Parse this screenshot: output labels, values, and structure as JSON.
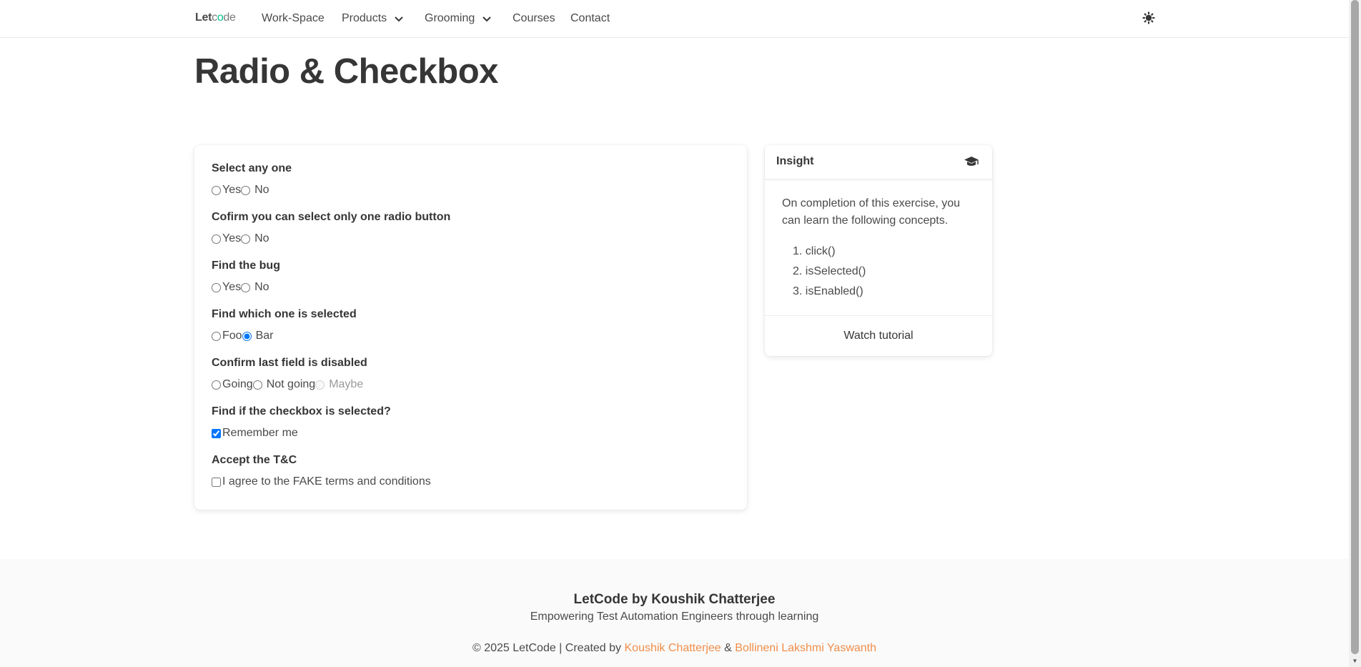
{
  "nav": {
    "logo_let": "Let",
    "logo_c": "c",
    "logo_o": "o",
    "logo_de": "de",
    "items": [
      {
        "label": "Work-Space"
      },
      {
        "label": "Products"
      },
      {
        "label": "Grooming"
      },
      {
        "label": "Courses"
      },
      {
        "label": "Contact"
      }
    ]
  },
  "page": {
    "title": "Radio & Checkbox"
  },
  "form": {
    "fields": [
      {
        "label": "Select any one",
        "options": [
          {
            "label": "Yes",
            "checked": false
          },
          {
            "label": "No",
            "checked": false
          }
        ]
      },
      {
        "label": "Cofirm you can select only one radio button",
        "options": [
          {
            "label": "Yes",
            "checked": false
          },
          {
            "label": "No",
            "checked": false
          }
        ]
      },
      {
        "label": "Find the bug",
        "options": [
          {
            "label": "Yes",
            "checked": false
          },
          {
            "label": "No",
            "checked": false
          }
        ]
      },
      {
        "label": "Find which one is selected",
        "options": [
          {
            "label": "Foo",
            "checked": false
          },
          {
            "label": "Bar",
            "checked": true
          }
        ]
      },
      {
        "label": "Confirm last field is disabled",
        "options": [
          {
            "label": "Going",
            "checked": false
          },
          {
            "label": "Not going",
            "checked": false
          },
          {
            "label": "Maybe",
            "checked": false,
            "disabled": true
          }
        ]
      },
      {
        "label": "Find if the checkbox is selected?",
        "options": [
          {
            "label": "Remember me",
            "checked": true
          }
        ]
      },
      {
        "label": "Accept the T&C",
        "options": [
          {
            "label": "I agree to the FAKE terms and conditions",
            "checked": false
          }
        ]
      }
    ]
  },
  "insight": {
    "title": "Insight",
    "icon": "graduation-cap-icon",
    "description": "On completion of this exercise, you can learn the following concepts.",
    "concepts": [
      "1. click()",
      "2. isSelected()",
      "3. isEnabled()"
    ],
    "watch_label": "Watch tutorial"
  },
  "footer": {
    "title": "LetCode by Koushik Chatterjee",
    "subtitle": "Empowering Test Automation Engineers through learning",
    "copy_prefix": "© 2025 LetCode | Created by",
    "author1": "Koushik Chatterjee",
    "amp": "&",
    "author2": "Bollineni Lakshmi Yaswanth"
  },
  "colors": {
    "accent": "#0075ff",
    "link_orange": "#ef8e4b",
    "logo_green": "#00c48c"
  }
}
